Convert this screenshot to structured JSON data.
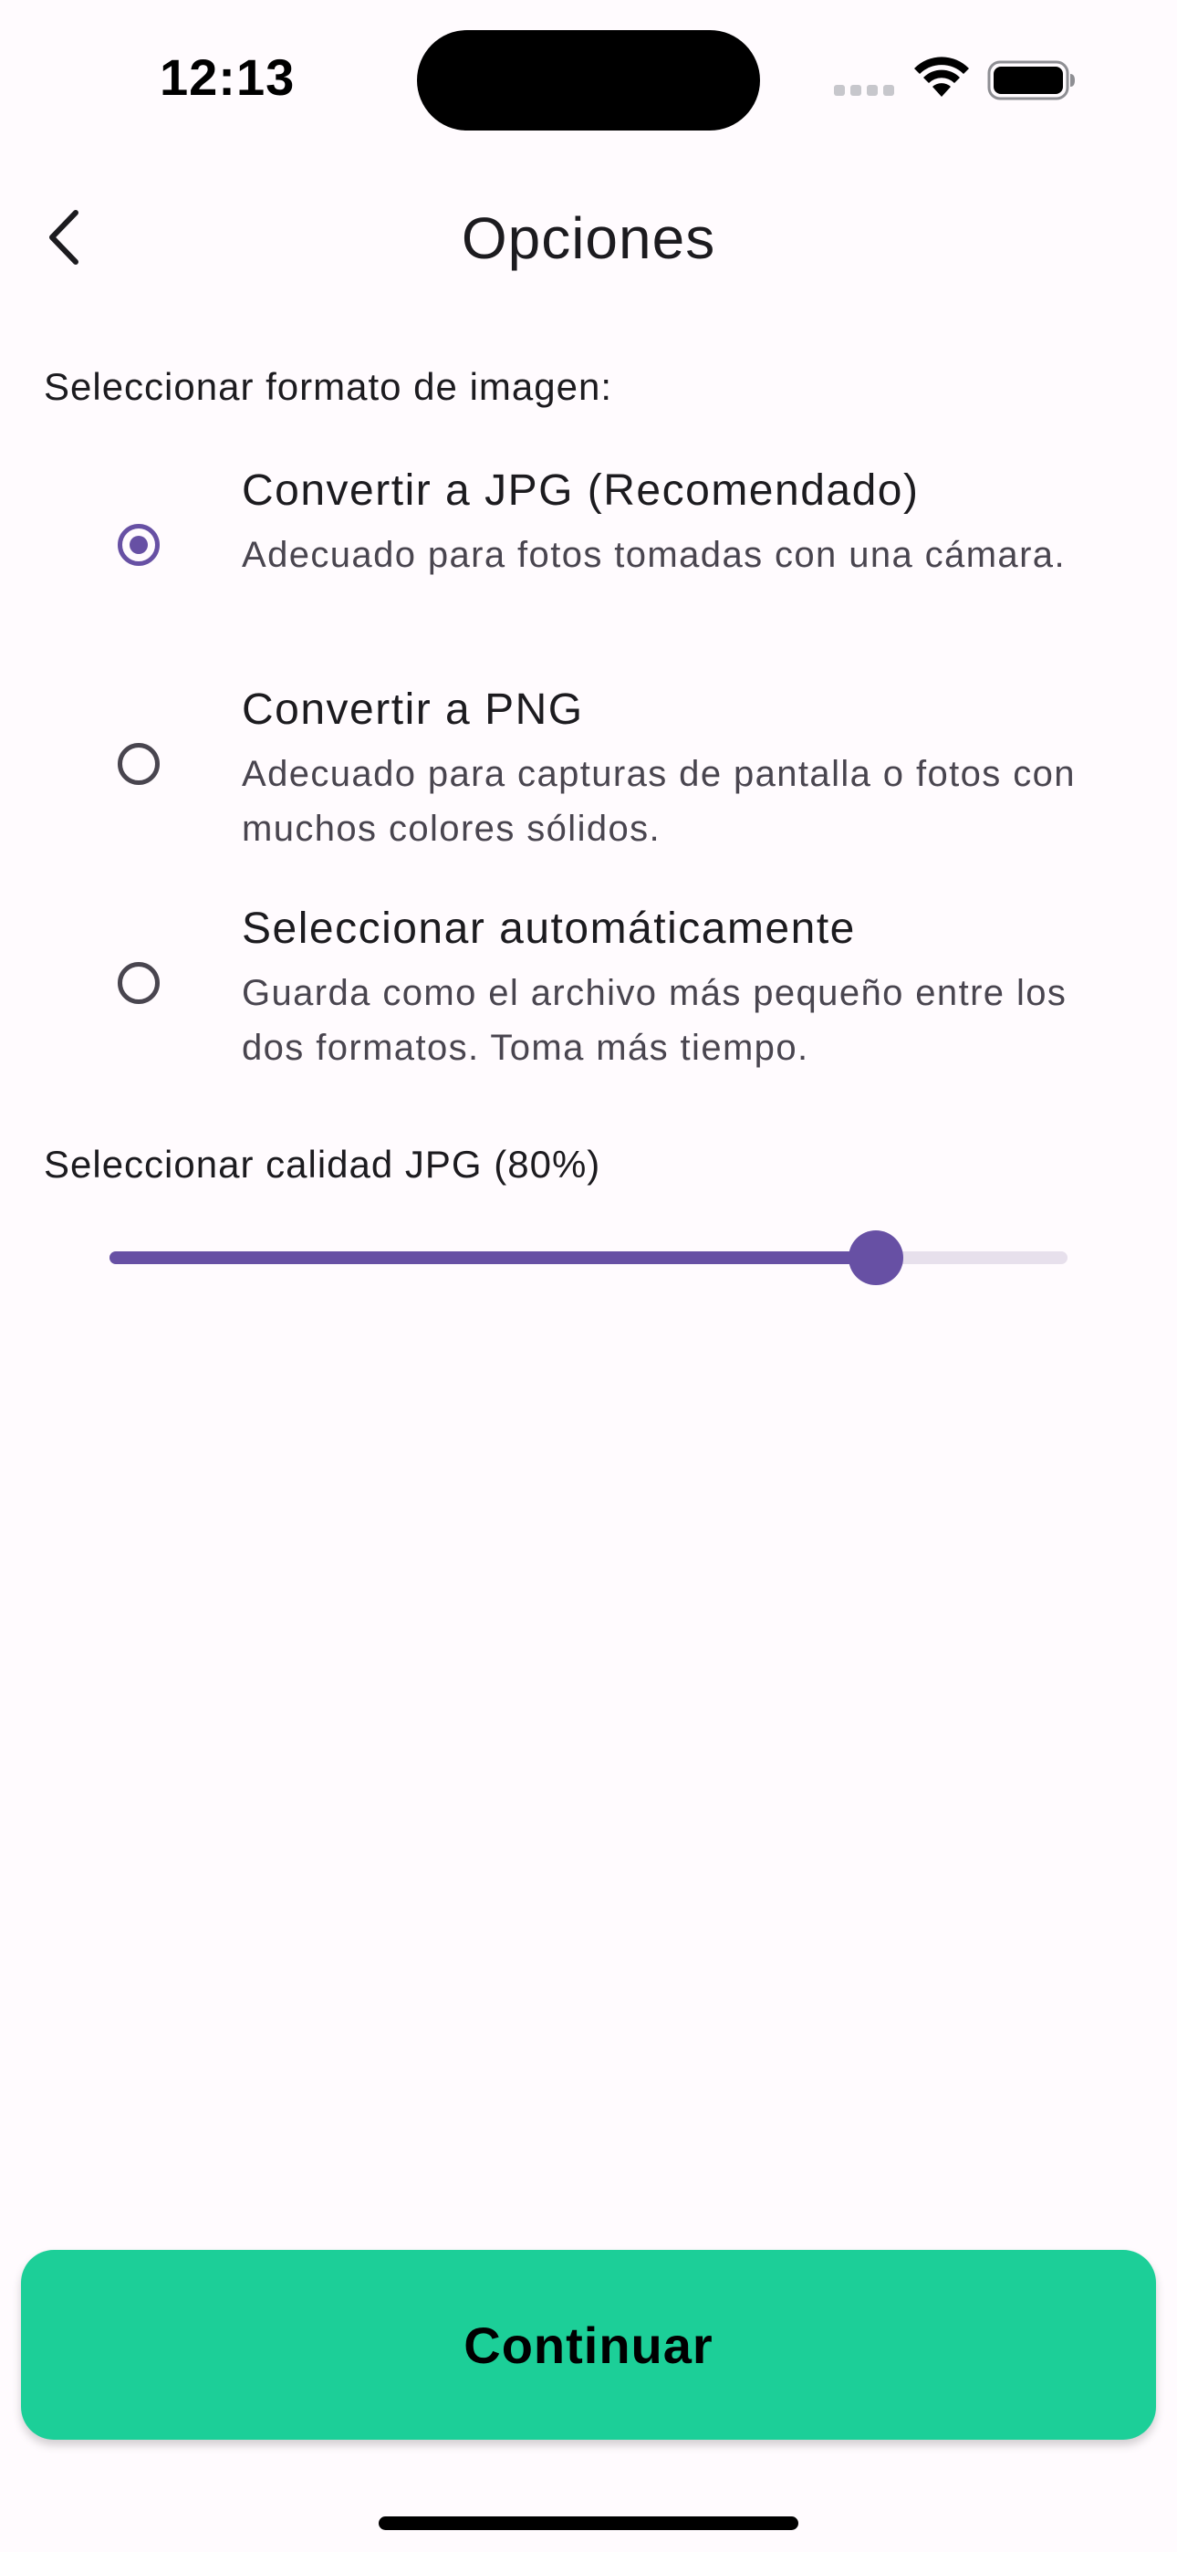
{
  "status_bar": {
    "time": "12:13"
  },
  "header": {
    "title": "Opciones",
    "back_icon": "chevron-left-icon"
  },
  "format_section": {
    "label": "Seleccionar formato de imagen:",
    "selected": "jpg",
    "options": [
      {
        "id": "jpg",
        "title": "Convertir a JPG (Recomendado)",
        "description": "Adecuado para fotos tomadas con una cámara."
      },
      {
        "id": "png",
        "title": "Convertir a PNG",
        "description": "Adecuado para capturas de pantalla o fotos con muchos colores sólidos."
      },
      {
        "id": "auto",
        "title": "Seleccionar automáticamente",
        "description": "Guarda como el archivo más pequeño entre los dos formatos. Toma más tiempo."
      }
    ]
  },
  "quality_section": {
    "label": "Seleccionar calidad JPG (80%)",
    "value_percent": 80
  },
  "footer": {
    "continue_label": "Continuar"
  },
  "colors": {
    "accent": "#6750a4",
    "button": "#1ccf98",
    "background": "#fffbfe"
  }
}
